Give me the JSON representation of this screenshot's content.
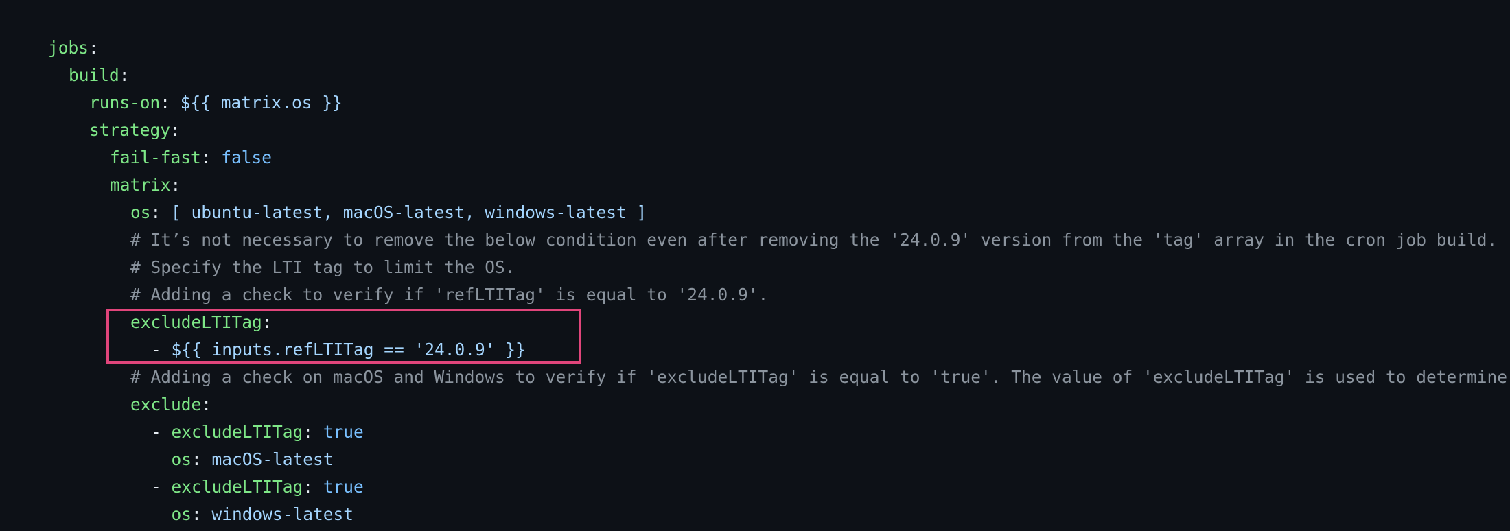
{
  "lines": {
    "jobs_key": "jobs",
    "build_key": "build",
    "runs_on_key": "runs-on",
    "runs_on_val": "${{ matrix.os }}",
    "strategy_key": "strategy",
    "fail_fast_key": "fail-fast",
    "fail_fast_val": "false",
    "matrix_key": "matrix",
    "os_key": "os",
    "os_val": "[ ubuntu-latest, macOS-latest, windows-latest ]",
    "comment_1": "# It’s not necessary to remove the below condition even after removing the '24.0.9' version from the 'tag' array in the cron job build.",
    "comment_2": "# Specify the LTI tag to limit the OS.",
    "comment_3": "# Adding a check to verify if 'refLTITag' is equal to '24.0.9'.",
    "exclude_lti_key": "excludeLTITag",
    "exclude_lti_item_dash": "- ",
    "exclude_lti_item_val": "${{ inputs.refLTITag == '24.0.9' }}",
    "comment_4": "# Adding a check on macOS and Windows to verify if 'excludeLTITag' is equal to 'true'. The value of 'excludeLTITag' is used to determine",
    "exclude_key": "exclude",
    "ex1_dash": "- ",
    "ex1_key": "excludeLTITag",
    "ex1_val": "true",
    "ex1_os_key": "os",
    "ex1_os_val": "macOS-latest",
    "ex2_dash": "- ",
    "ex2_key": "excludeLTITag",
    "ex2_val": "true",
    "ex2_os_key": "os",
    "ex2_os_val": "windows-latest"
  },
  "colors": {
    "background": "#0d1117",
    "key": "#7ee787",
    "value": "#a5d6ff",
    "literal": "#79c0ff",
    "comment": "#8b949e",
    "highlight_border": "#e0457b"
  }
}
